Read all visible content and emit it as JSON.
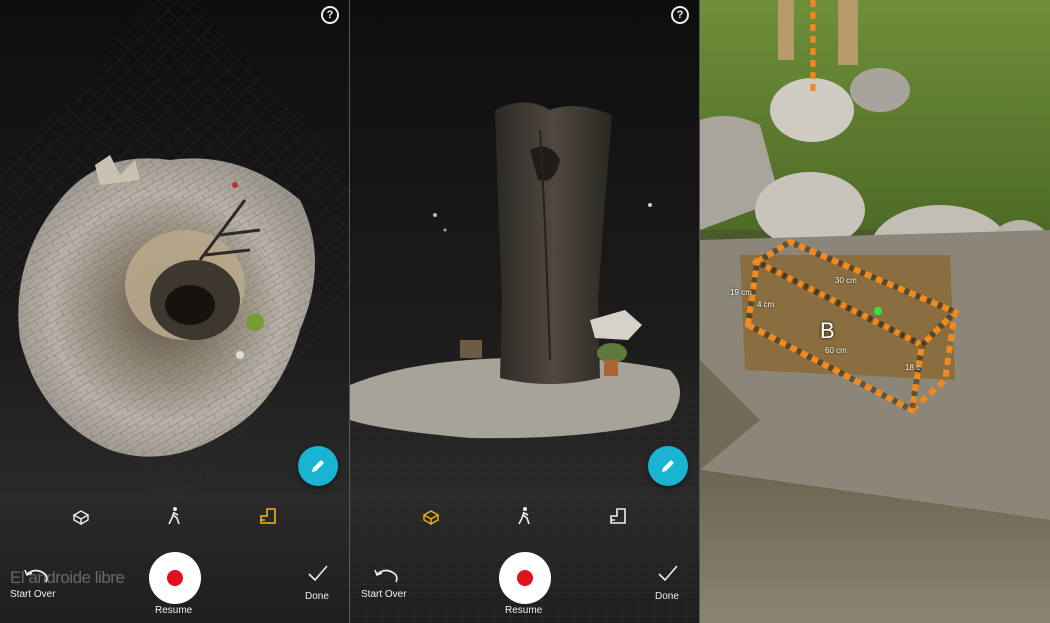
{
  "screens": [
    {
      "help_label": "?",
      "start_over_label": "Start Over",
      "resume_label": "Resume",
      "done_label": "Done",
      "active_mode": "floor-plan",
      "modes": [
        "cube-icon",
        "walk-icon",
        "floor-plan-icon"
      ]
    },
    {
      "help_label": "?",
      "start_over_label": "Start Over",
      "resume_label": "Resume",
      "done_label": "Done",
      "active_mode": "cube",
      "modes": [
        "cube-icon",
        "walk-icon",
        "floor-plan-icon"
      ]
    }
  ],
  "watermark": "El androide libre",
  "ar_measure": {
    "label": "B",
    "dimensions": [
      "19 cm",
      "4 cm",
      "30 cm",
      "60 cm",
      "18 c"
    ]
  },
  "colors": {
    "accent_fab": "#19b4d2",
    "active_mode": "#f0b21c",
    "record": "#e0101e",
    "measure_outline": "#f08a1e",
    "measure_point": "#2ee84a"
  }
}
